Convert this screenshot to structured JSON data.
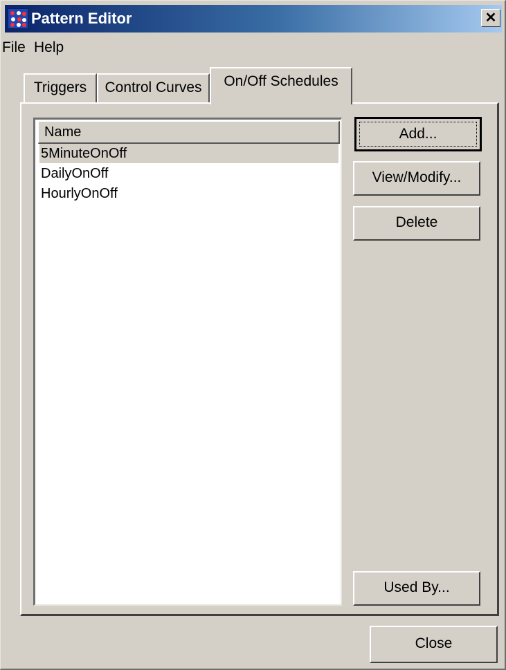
{
  "window": {
    "title": "Pattern Editor",
    "close_glyph": "✕"
  },
  "menu": [
    "File",
    "Help"
  ],
  "tabs": [
    {
      "label": "Triggers"
    },
    {
      "label": "Control Curves"
    },
    {
      "label": "On/Off Schedules",
      "active": true
    }
  ],
  "list": {
    "header": "Name",
    "rows": [
      "5MinuteOnOff",
      "DailyOnOff",
      "HourlyOnOff"
    ],
    "selected": "5MinuteOnOff"
  },
  "buttons": {
    "add": "Add...",
    "view_modify": "View/Modify...",
    "delete": "Delete",
    "used_by": "Used By...",
    "close": "Close"
  },
  "colors": {
    "title_gradient_start": "#0a246a",
    "title_gradient_end": "#a6caf0",
    "face": "#d4d0c8"
  }
}
